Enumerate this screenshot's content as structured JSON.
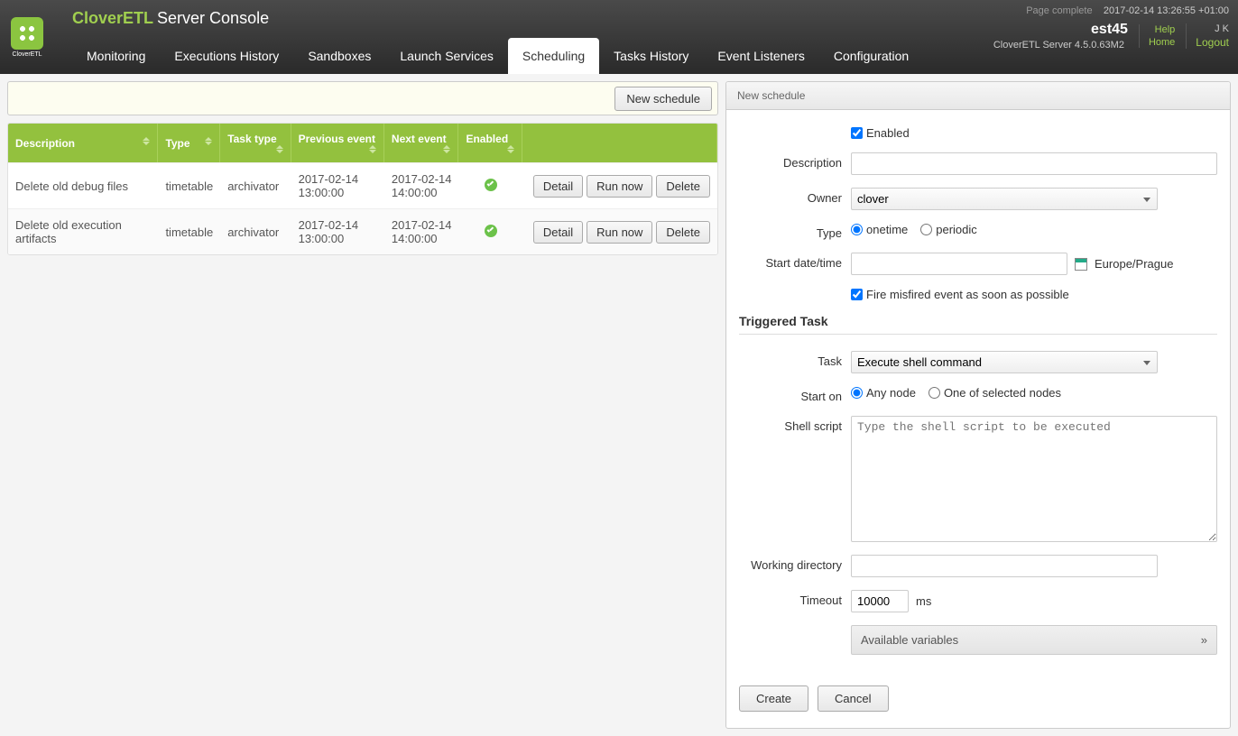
{
  "header": {
    "logo_text": "CloverETL",
    "title_brand": "CloverETL",
    "title_rest": "Server Console",
    "page_complete": "Page complete",
    "timestamp": "2017-02-14 13:26:55 +01:00",
    "est": "est45",
    "server_version": "CloverETL Server 4.5.0.63M2",
    "help": "Help",
    "home": "Home",
    "username": "J K",
    "logout": "Logout"
  },
  "nav": {
    "items": [
      "Monitoring",
      "Executions History",
      "Sandboxes",
      "Launch Services",
      "Scheduling",
      "Tasks History",
      "Event Listeners",
      "Configuration"
    ],
    "active": "Scheduling"
  },
  "toolbar": {
    "new_schedule": "New schedule"
  },
  "table": {
    "headers": [
      "Description",
      "Type",
      "Task type",
      "Previous event",
      "Next event",
      "Enabled",
      ""
    ],
    "rows": [
      {
        "description": "Delete old debug files",
        "type": "timetable",
        "task_type": "archivator",
        "prev": "2017-02-14 13:00:00",
        "next": "2017-02-14 14:00:00",
        "enabled": true
      },
      {
        "description": "Delete old execution artifacts",
        "type": "timetable",
        "task_type": "archivator",
        "prev": "2017-02-14 13:00:00",
        "next": "2017-02-14 14:00:00",
        "enabled": true
      }
    ],
    "actions": {
      "detail": "Detail",
      "run_now": "Run now",
      "delete": "Delete"
    }
  },
  "panel": {
    "title": "New schedule",
    "labels": {
      "enabled": "Enabled",
      "description": "Description",
      "owner": "Owner",
      "type": "Type",
      "start": "Start date/time",
      "fire_misfired": "Fire misfired event as soon as possible",
      "triggered_task": "Triggered Task",
      "task": "Task",
      "start_on": "Start on",
      "shell_script": "Shell script",
      "working_dir": "Working directory",
      "timeout": "Timeout",
      "ms": "ms",
      "avail_vars": "Available variables",
      "create": "Create",
      "cancel": "Cancel"
    },
    "values": {
      "enabled_checked": true,
      "description": "",
      "owner": "clover",
      "type_options": {
        "onetime": "onetime",
        "periodic": "periodic"
      },
      "type_selected": "onetime",
      "start_date": "",
      "timezone": "Europe/Prague",
      "fire_misfired_checked": true,
      "task": "Execute shell command",
      "start_on_options": {
        "any": "Any node",
        "selected": "One of selected nodes"
      },
      "start_on_selected": "any",
      "shell_placeholder": "Type the shell script to be executed",
      "shell_value": "",
      "working_dir": "",
      "timeout": "10000"
    }
  }
}
